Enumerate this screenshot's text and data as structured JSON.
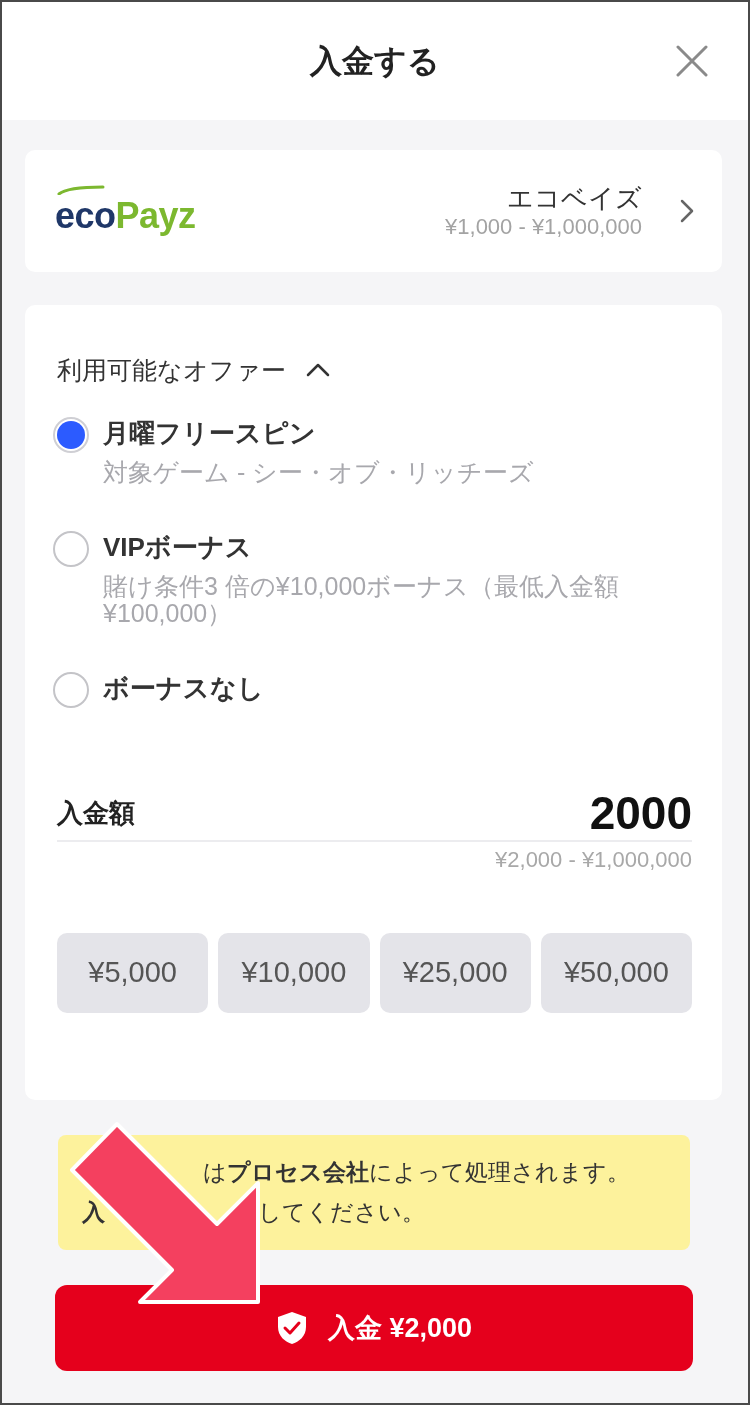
{
  "header": {
    "title": "入金する"
  },
  "payment_method": {
    "logo": [
      "eco",
      "Payz"
    ],
    "name": "エコベイズ",
    "range": "¥1,000 - ¥1,000,000"
  },
  "offers": {
    "title": "利用可能なオファー",
    "expanded": true,
    "options": [
      {
        "label": "月曜フリースピン",
        "description": "対象ゲーム - シー・オブ・リッチーズ",
        "selected": true
      },
      {
        "label": "VIPボーナス",
        "description": "賭け条件3 倍の¥10,000ボーナス（最低入金額¥100,000）",
        "selected": false
      },
      {
        "label": "ボーナスなし",
        "selected": false
      }
    ]
  },
  "amount": {
    "label": "入金額",
    "value": "2000",
    "range": "¥2,000 - ¥1,000,000",
    "presets": [
      "¥5,000",
      "¥10,000",
      "¥25,000",
      "¥50,000"
    ]
  },
  "notice": {
    "lines": [
      [
        "は**プロセス会社**によって処理されます。"
      ],
      [
        "入",
        "してください。"
      ]
    ]
  },
  "deposit_button": {
    "label": "入金 ¥2,000"
  }
}
